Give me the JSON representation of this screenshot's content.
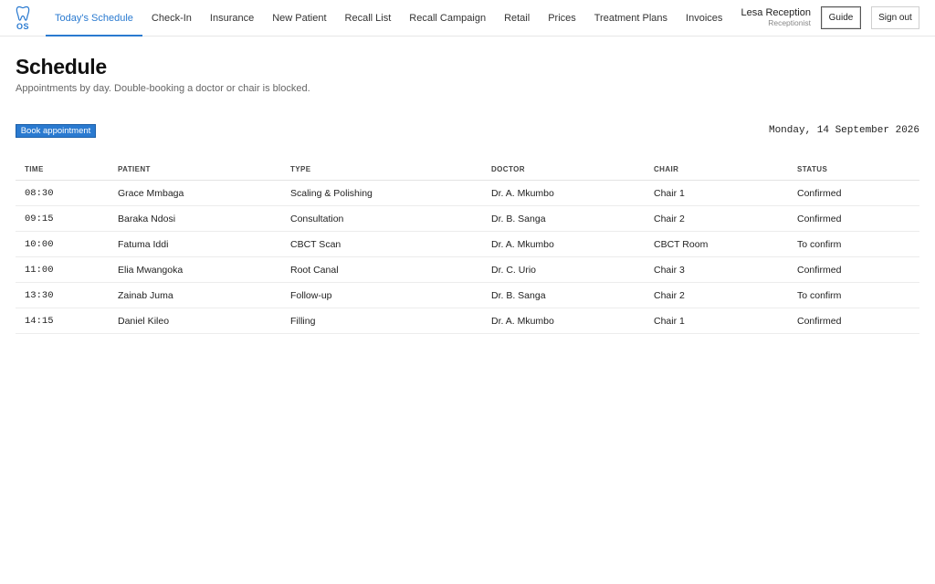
{
  "logo": {
    "text": "OS",
    "icon": "tooth-icon"
  },
  "nav": {
    "items": [
      {
        "label": "Today's Schedule",
        "active": true
      },
      {
        "label": "Check-In",
        "active": false
      },
      {
        "label": "Insurance",
        "active": false
      },
      {
        "label": "New Patient",
        "active": false
      },
      {
        "label": "Recall List",
        "active": false
      },
      {
        "label": "Recall Campaign",
        "active": false
      },
      {
        "label": "Retail",
        "active": false
      },
      {
        "label": "Prices",
        "active": false
      },
      {
        "label": "Treatment Plans",
        "active": false
      },
      {
        "label": "Invoices",
        "active": false
      }
    ]
  },
  "user": {
    "name": "Lesa Reception",
    "role": "Receptionist"
  },
  "buttons": {
    "guide": "Guide",
    "sign_out": "Sign out",
    "book": "Book appointment"
  },
  "page": {
    "title": "Schedule",
    "subtitle": "Appointments by day. Double-booking a doctor or chair is blocked.",
    "date": "Monday, 14 September 2026"
  },
  "table": {
    "headers": {
      "time": "TIME",
      "patient": "PATIENT",
      "type": "TYPE",
      "doctor": "DOCTOR",
      "chair": "CHAIR",
      "status": "STATUS"
    },
    "rows": [
      {
        "time": "08:30",
        "patient": "Grace Mmbaga",
        "type": "Scaling & Polishing",
        "doctor": "Dr. A. Mkumbo",
        "chair": "Chair 1",
        "status": "Confirmed"
      },
      {
        "time": "09:15",
        "patient": "Baraka Ndosi",
        "type": "Consultation",
        "doctor": "Dr. B. Sanga",
        "chair": "Chair 2",
        "status": "Confirmed"
      },
      {
        "time": "10:00",
        "patient": "Fatuma Iddi",
        "type": "CBCT Scan",
        "doctor": "Dr. A. Mkumbo",
        "chair": "CBCT Room",
        "status": "To confirm"
      },
      {
        "time": "11:00",
        "patient": "Elia Mwangoka",
        "type": "Root Canal",
        "doctor": "Dr. C. Urio",
        "chair": "Chair 3",
        "status": "Confirmed"
      },
      {
        "time": "13:30",
        "patient": "Zainab Juma",
        "type": "Follow-up",
        "doctor": "Dr. B. Sanga",
        "chair": "Chair 2",
        "status": "To confirm"
      },
      {
        "time": "14:15",
        "patient": "Daniel Kileo",
        "type": "Filling",
        "doctor": "Dr. A. Mkumbo",
        "chair": "Chair 1",
        "status": "Confirmed"
      }
    ]
  },
  "colors": {
    "accent": "#2a7ad0",
    "confirmed": "#2e8b3e",
    "to_confirm": "#c07a10"
  }
}
